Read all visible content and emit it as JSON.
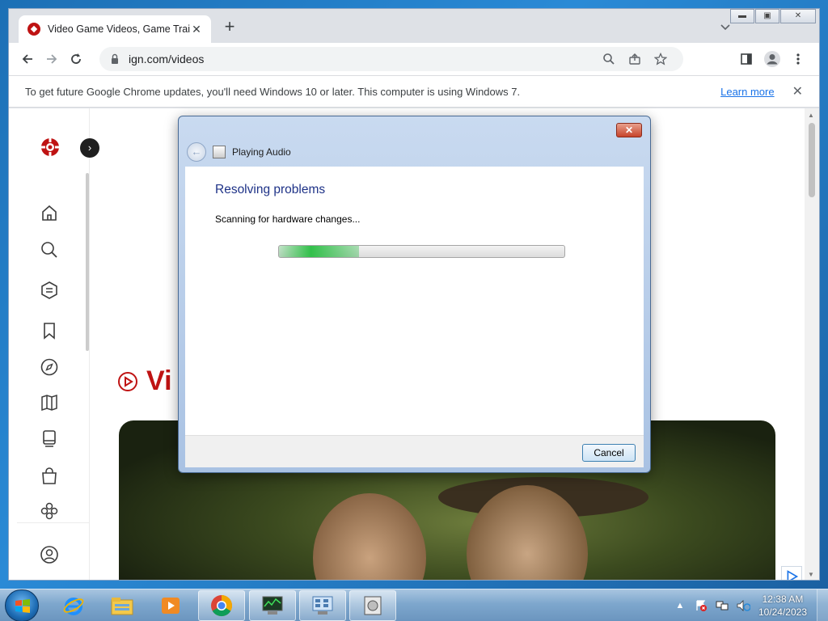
{
  "browser": {
    "tab": {
      "title": "Video Game Videos, Game Traile"
    },
    "url": "ign.com/videos",
    "infobar": {
      "message": "To get future Google Chrome updates, you'll need Windows 10 or later. This computer is using Windows 7.",
      "learn_more": "Learn more"
    }
  },
  "page": {
    "heading": "Vi",
    "sidebar_icons": [
      "home-icon",
      "search-icon",
      "hexagon-menu-icon",
      "bookmark-icon",
      "compass-icon",
      "map-icon",
      "console-icon",
      "shopping-bag-icon",
      "puzzle-icon",
      "profile-icon"
    ]
  },
  "dialog": {
    "title": "Playing Audio",
    "heading": "Resolving problems",
    "status": "Scanning for hardware changes...",
    "progress_fraction": 0.28,
    "cancel_label": "Cancel"
  },
  "taskbar": {
    "items": [
      "ie-icon",
      "explorer-icon",
      "media-player-icon",
      "chrome-icon",
      "task-manager-icon",
      "control-panel-icon",
      "troubleshooter-icon"
    ],
    "time": "12:38 AM",
    "date": "10/24/2023"
  },
  "colors": {
    "ign_red": "#bf1313",
    "dialog_heading": "#1e3287",
    "link": "#1a73e8"
  }
}
